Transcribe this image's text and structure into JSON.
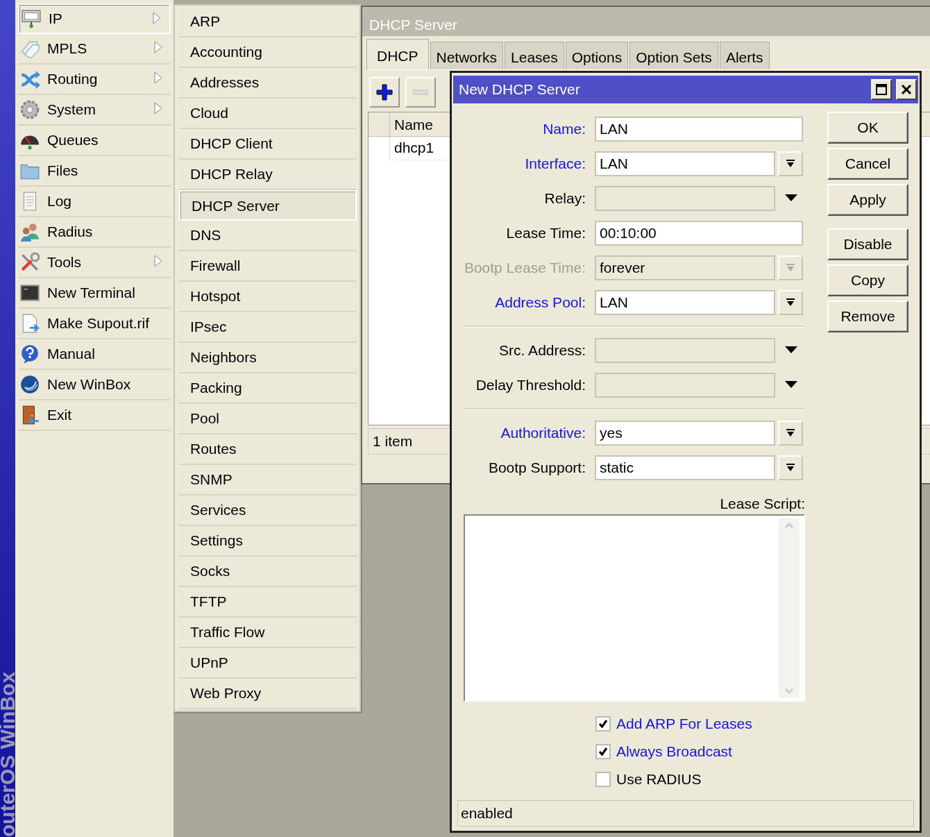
{
  "brand_strip": {
    "text": "outerOS WinBox"
  },
  "main_menu": [
    {
      "label": "IP",
      "has_submenu": true,
      "selected": true
    },
    {
      "label": "MPLS",
      "has_submenu": true,
      "selected": false
    },
    {
      "label": "Routing",
      "has_submenu": true,
      "selected": false
    },
    {
      "label": "System",
      "has_submenu": true,
      "selected": false
    },
    {
      "label": "Queues",
      "has_submenu": false,
      "selected": false
    },
    {
      "label": "Files",
      "has_submenu": false,
      "selected": false
    },
    {
      "label": "Log",
      "has_submenu": false,
      "selected": false
    },
    {
      "label": "Radius",
      "has_submenu": false,
      "selected": false
    },
    {
      "label": "Tools",
      "has_submenu": true,
      "selected": false
    },
    {
      "label": "New Terminal",
      "has_submenu": false,
      "selected": false
    },
    {
      "label": "Make Supout.rif",
      "has_submenu": false,
      "selected": false
    },
    {
      "label": "Manual",
      "has_submenu": false,
      "selected": false
    },
    {
      "label": "New WinBox",
      "has_submenu": false,
      "selected": false
    },
    {
      "label": "Exit",
      "has_submenu": false,
      "selected": false
    }
  ],
  "submenu": [
    {
      "label": "ARP",
      "selected": false
    },
    {
      "label": "Accounting",
      "selected": false
    },
    {
      "label": "Addresses",
      "selected": false
    },
    {
      "label": "Cloud",
      "selected": false
    },
    {
      "label": "DHCP Client",
      "selected": false
    },
    {
      "label": "DHCP Relay",
      "selected": false
    },
    {
      "label": "DHCP Server",
      "selected": true
    },
    {
      "label": "DNS",
      "selected": false
    },
    {
      "label": "Firewall",
      "selected": false
    },
    {
      "label": "Hotspot",
      "selected": false
    },
    {
      "label": "IPsec",
      "selected": false
    },
    {
      "label": "Neighbors",
      "selected": false
    },
    {
      "label": "Packing",
      "selected": false
    },
    {
      "label": "Pool",
      "selected": false
    },
    {
      "label": "Routes",
      "selected": false
    },
    {
      "label": "SNMP",
      "selected": false
    },
    {
      "label": "Services",
      "selected": false
    },
    {
      "label": "Settings",
      "selected": false
    },
    {
      "label": "Socks",
      "selected": false
    },
    {
      "label": "TFTP",
      "selected": false
    },
    {
      "label": "Traffic Flow",
      "selected": false
    },
    {
      "label": "UPnP",
      "selected": false
    },
    {
      "label": "Web Proxy",
      "selected": false
    }
  ],
  "dhcp_window": {
    "title": "DHCP Server",
    "tabs": [
      {
        "label": "DHCP",
        "selected": true
      },
      {
        "label": "Networks",
        "selected": false
      },
      {
        "label": "Leases",
        "selected": false
      },
      {
        "label": "Options",
        "selected": false
      },
      {
        "label": "Option Sets",
        "selected": false
      },
      {
        "label": "Alerts",
        "selected": false
      }
    ],
    "toolbar": [
      {
        "kind": "add",
        "disabled": false
      },
      {
        "kind": "remove",
        "disabled": true
      }
    ],
    "table": {
      "columns": [
        "Name"
      ],
      "rows": [
        [
          "dhcp1"
        ]
      ]
    },
    "status": "1 item"
  },
  "dialog": {
    "title": "New DHCP Server",
    "field_groups": [
      [
        {
          "label": "Name:",
          "value": "LAN",
          "kind": "text",
          "highlighted": true,
          "disabled": false
        },
        {
          "label": "Interface:",
          "value": "LAN",
          "kind": "combo",
          "highlighted": true,
          "disabled": false
        },
        {
          "label": "Relay:",
          "kind": "dropdown",
          "highlighted": false,
          "disabled": false
        },
        {
          "label": "Lease Time:",
          "value": "00:10:00",
          "kind": "text",
          "highlighted": false,
          "disabled": false
        },
        {
          "label": "Bootp Lease Time:",
          "value": "forever",
          "kind": "combo",
          "highlighted": false,
          "disabled": true
        },
        {
          "label": "Address Pool:",
          "value": "LAN",
          "kind": "combo",
          "highlighted": true,
          "disabled": false
        }
      ],
      [
        {
          "label": "Src. Address:",
          "kind": "dropdown",
          "highlighted": false,
          "disabled": false
        },
        {
          "label": "Delay Threshold:",
          "kind": "dropdown",
          "highlighted": false,
          "disabled": false
        }
      ],
      [
        {
          "label": "Authoritative:",
          "value": "yes",
          "kind": "combo",
          "highlighted": true,
          "disabled": false
        },
        {
          "label": "Bootp Support:",
          "value": "static",
          "kind": "combo",
          "highlighted": false,
          "disabled": false
        }
      ]
    ],
    "script_label": "Lease Script:",
    "checkboxes": [
      {
        "label": "Add ARP For Leases",
        "checked": true,
        "highlighted": true
      },
      {
        "label": "Always Broadcast",
        "checked": true,
        "highlighted": true
      },
      {
        "label": "Use RADIUS",
        "checked": false,
        "highlighted": false
      }
    ],
    "button_groups": [
      [
        "OK",
        "Cancel",
        "Apply"
      ],
      [
        "Disable",
        "Copy",
        "Remove"
      ]
    ],
    "status": "enabled"
  }
}
